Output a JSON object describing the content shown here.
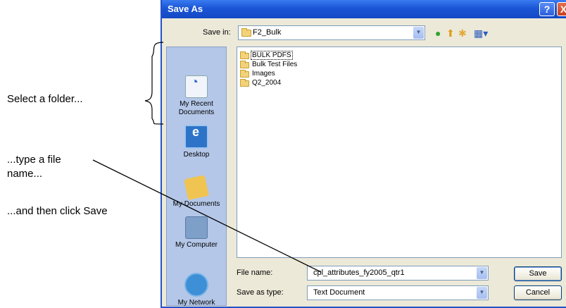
{
  "annotations": {
    "select_folder": "Select a folder...",
    "type_name": "...type a file name...",
    "click_save": "...and then click Save"
  },
  "dialog": {
    "title": "Save As",
    "help_glyph": "?",
    "close_glyph": "X",
    "save_in_label": "Save in:",
    "save_in_value": "F2_Bulk",
    "toolbar_icons": [
      "back-icon",
      "up-folder-icon",
      "new-folder-icon",
      "views-menu-icon"
    ]
  },
  "places": [
    {
      "label": "My Recent Documents",
      "icon": "recent-documents-icon"
    },
    {
      "label": "Desktop",
      "icon": "desktop-icon"
    },
    {
      "label": "My Documents",
      "icon": "my-documents-icon"
    },
    {
      "label": "My Computer",
      "icon": "my-computer-icon"
    },
    {
      "label": "My Network",
      "icon": "my-network-icon"
    }
  ],
  "files": [
    {
      "name": "BULK PDFS",
      "type": "folder"
    },
    {
      "name": "Bulk Test Files",
      "type": "folder"
    },
    {
      "name": "Images",
      "type": "folder"
    },
    {
      "name": "Q2_2004",
      "type": "folder"
    }
  ],
  "bottom": {
    "file_name_label": "File name:",
    "file_name_value": "cpl_attributes_fy2005_qtr1",
    "save_type_label": "Save as type:",
    "save_type_value": "Text Document",
    "save_button": "Save",
    "cancel_button": "Cancel"
  },
  "colors": {
    "titlebar": "#1a55d6",
    "dialog_bg": "#ece9d8",
    "places_bg": "#b4c7e8",
    "folder": "#f3d27a"
  }
}
